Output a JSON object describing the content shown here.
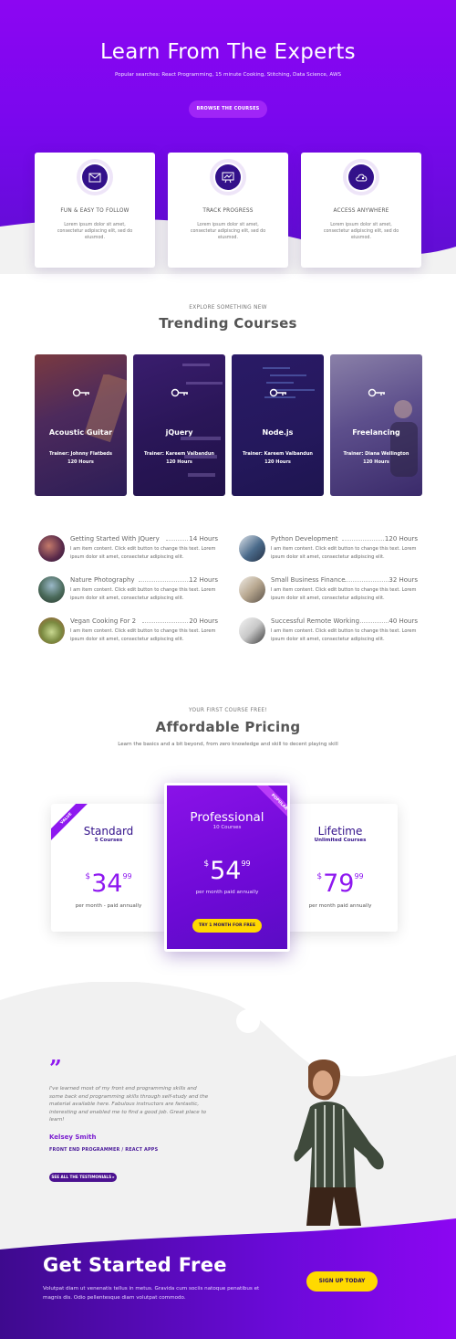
{
  "hero": {
    "title": "Learn From The Experts",
    "subtitle": "Popular searches: React Programming, 15 minute Cooking, Stitching, Data Science, AWS",
    "button": "BROWSE THE COURSES"
  },
  "features": [
    {
      "title": "FUN & EASY TO FOLLOW",
      "text": "Lorem ipsum dolor sit amet, consectetur adipiscing elit, sed do eiusmod.",
      "icon": "envelope-icon"
    },
    {
      "title": "TRACK PROGRESS",
      "text": "Lorem ipsum dolor sit amet, consectetur adipiscing elit, sed do eiusmod.",
      "icon": "chart-board-icon"
    },
    {
      "title": "ACCESS ANYWHERE",
      "text": "Lorem ipsum dolor sit amet, consectetur adipiscing elit, sed do eiusmod.",
      "icon": "cloud-icon"
    }
  ],
  "trending": {
    "eyebrow": "EXPLORE SOMETHING NEW",
    "title": "Trending Courses",
    "cards": [
      {
        "name": "Acoustic Guitar",
        "trainer": "Trainer: Johnny Flatbeds",
        "hours": "120 Hours",
        "icon": "key-icon"
      },
      {
        "name": "jQuery",
        "trainer": "Trainer: Kareem Valbandun",
        "hours": "120 Hours",
        "icon": "key-icon"
      },
      {
        "name": "Node.js",
        "trainer": "Trainer: Kareem Valbandun",
        "hours": "120 Hours",
        "icon": "key-icon"
      },
      {
        "name": "Freelancing",
        "trainer": "Trainer: Diana Wellington",
        "hours": "120 Hours",
        "icon": "key-icon"
      }
    ]
  },
  "course_list": [
    {
      "title": "Getting Started With JQuery",
      "hours": "14 Hours",
      "desc": "I am item content. Click edit button to change this text. Lorem ipsum dolor sit amet, consectetur adipiscing elit."
    },
    {
      "title": "Python Development",
      "hours": "120 Hours",
      "desc": "I am item content. Click edit button to change this text. Lorem ipsum dolor sit amet, consectetur adipiscing elit."
    },
    {
      "title": "Nature Photography",
      "hours": "12 Hours",
      "desc": "I am item content. Click edit button to change this text. Lorem ipsum dolor sit amet, consectetur adipiscing elit."
    },
    {
      "title": "Small Business Finance",
      "hours": "32 Hours",
      "desc": "I am item content. Click edit button to change this text. Lorem ipsum dolor sit amet, consectetur adipiscing elit."
    },
    {
      "title": "Vegan Cooking For 2",
      "hours": "20 Hours",
      "desc": "I am item content. Click edit button to change this text. Lorem ipsum dolor sit amet, consectetur adipiscing elit."
    },
    {
      "title": "Successful Remote Working",
      "hours": "40 Hours",
      "desc": "I am item content. Click edit button to change this text. Lorem ipsum dolor sit amet, consectetur adipiscing elit."
    }
  ],
  "pricing": {
    "eyebrow": "YOUR FIRST COURSE FREE!",
    "title": "Affordable Pricing",
    "subtitle": "Learn the basics and a bit beyond, from zero knowledge and skill to decent playing skill",
    "plans": [
      {
        "name": "Standard",
        "count": "5 Courses",
        "currency": "$",
        "amount": "34",
        "cents": "99",
        "note": "per month - paid annually",
        "ribbon": "VALUE"
      },
      {
        "name": "Professional",
        "count": "10 Courses",
        "currency": "$",
        "amount": "54",
        "cents": "99",
        "note": "per month paid annually",
        "ribbon": "POPULAR",
        "button": "TRY 1 MONTH FOR FREE"
      },
      {
        "name": "Lifetime",
        "count": "Unlimited Courses",
        "currency": "$",
        "amount": "79",
        "cents": "99",
        "note": "per month paid annually"
      }
    ]
  },
  "testimonial": {
    "quote": "I've learned most of my front end programming skills and some back end programming skills through self-study and the material available here. Fabulous instructors are fantastic, interesting and enabled me to find a good job. Great place to learn!",
    "name": "Kelsey Smith",
    "role": "FRONT END PROGRAMMER / REACT APPS",
    "button": "SEE ALL THE TESTIMONIALS ▸"
  },
  "cta": {
    "title": "Get Started Free",
    "text": "Volutpat diam ut venenatis tellus in metus. Gravida cum sociis natoque penatibus et magnis dis. Odio pellentesque diam volutpat commodo.",
    "button": "SIGN UP TODAY"
  },
  "colors": {
    "brand": "#8c06f2",
    "dark": "#33118a",
    "yellow": "#ffd900"
  }
}
